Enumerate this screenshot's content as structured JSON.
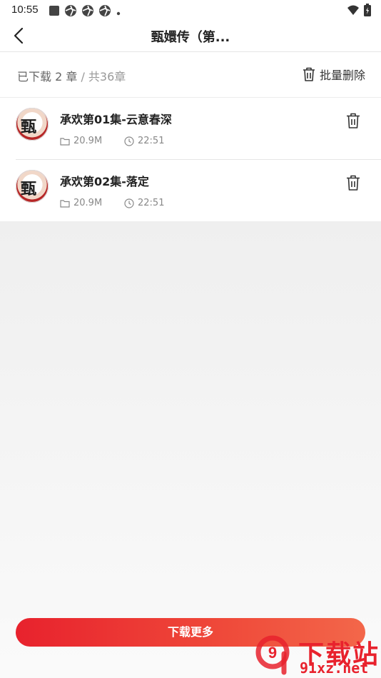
{
  "status_bar": {
    "time": "10:55"
  },
  "header": {
    "title": "甄嬛传（第..."
  },
  "summary": {
    "downloaded": "已下载 2 章",
    "separator": " / ",
    "total": "共36章",
    "batch_delete_label": "批量删除"
  },
  "items": [
    {
      "title": "承欢第01集-云意春深",
      "size": "20.9M",
      "duration": "22:51"
    },
    {
      "title": "承欢第02集-落定",
      "size": "20.9M",
      "duration": "22:51"
    }
  ],
  "footer": {
    "download_more_label": "下载更多"
  },
  "watermark": {
    "brand": "下载站",
    "domain": "91xz.net",
    "logo_text": "9"
  },
  "colors": {
    "accent": "#e8222d",
    "accent_end": "#f3674a"
  }
}
